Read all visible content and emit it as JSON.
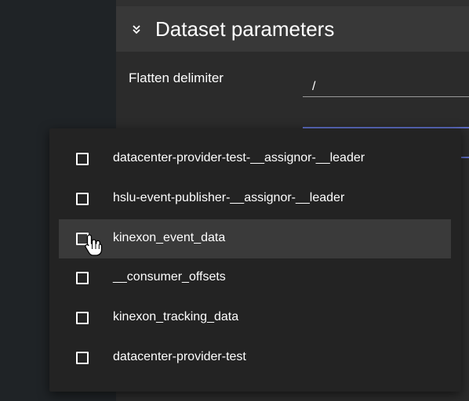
{
  "panel": {
    "title": "Dataset parameters",
    "collapse_icon": "chevron-double-down-icon"
  },
  "parameters": {
    "flatten_delimiter": {
      "label": "Flatten delimiter",
      "value": "/"
    }
  },
  "dropdown": {
    "options": [
      {
        "label": "datacenter-provider-test-__assignor-__leader",
        "checked": false,
        "hovered": false
      },
      {
        "label": "hslu-event-publisher-__assignor-__leader",
        "checked": false,
        "hovered": false
      },
      {
        "label": "kinexon_event_data",
        "checked": false,
        "hovered": true
      },
      {
        "label": "__consumer_offsets",
        "checked": false,
        "hovered": false
      },
      {
        "label": "kinexon_tracking_data",
        "checked": false,
        "hovered": false
      },
      {
        "label": "datacenter-provider-test",
        "checked": false,
        "hovered": false
      }
    ]
  },
  "cursor": {
    "icon": "hand-pointer-icon"
  },
  "colors": {
    "page_background": "#303030",
    "panel_background": "#2b2b2b",
    "panel_header": "#383838",
    "dropdown_background": "#232323",
    "hover_row": "#3a3a3a",
    "accent": "#5c6bc0"
  }
}
